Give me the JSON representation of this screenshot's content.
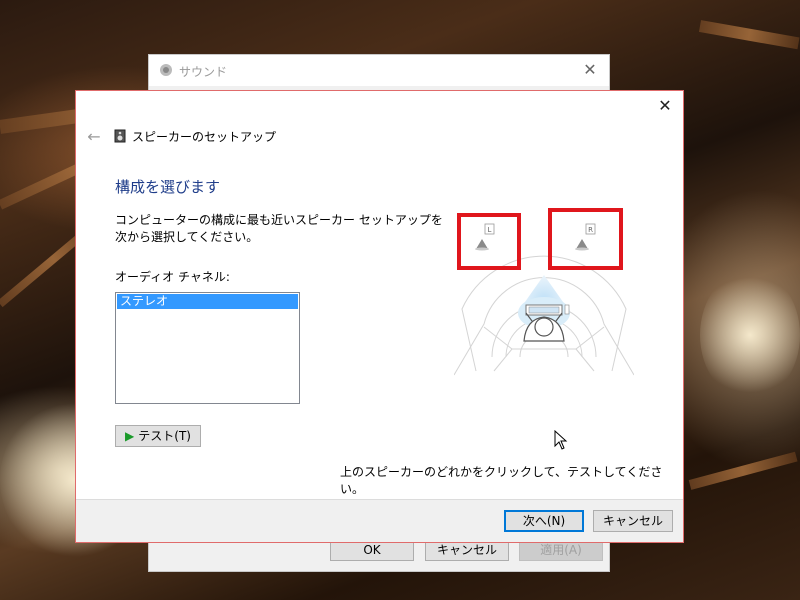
{
  "background_window": {
    "title": "サウンド",
    "buttons": {
      "ok": "OK",
      "cancel": "キャンセル",
      "apply": "適用(A)"
    }
  },
  "wizard": {
    "title": "スピーカーのセットアップ",
    "heading": "構成を選びます",
    "description": "コンピューターの構成に最も近いスピーカー セットアップを次から選択してください。",
    "channel_label": "オーディオ チャネル:",
    "channels": [
      "ステレオ"
    ],
    "selected_channel": "ステレオ",
    "test_button": "テスト(T)",
    "speakers": {
      "left_label": "L",
      "right_label": "R"
    },
    "instruction": "上のスピーカーのどれかをクリックして、テストしてください。",
    "buttons": {
      "next": "次へ(N)",
      "cancel": "キャンセル"
    }
  },
  "colors": {
    "heading": "#1f3d8a",
    "selection": "#3399ff",
    "highlight_box": "#e0161c",
    "play_icon": "#1a9a2a"
  }
}
